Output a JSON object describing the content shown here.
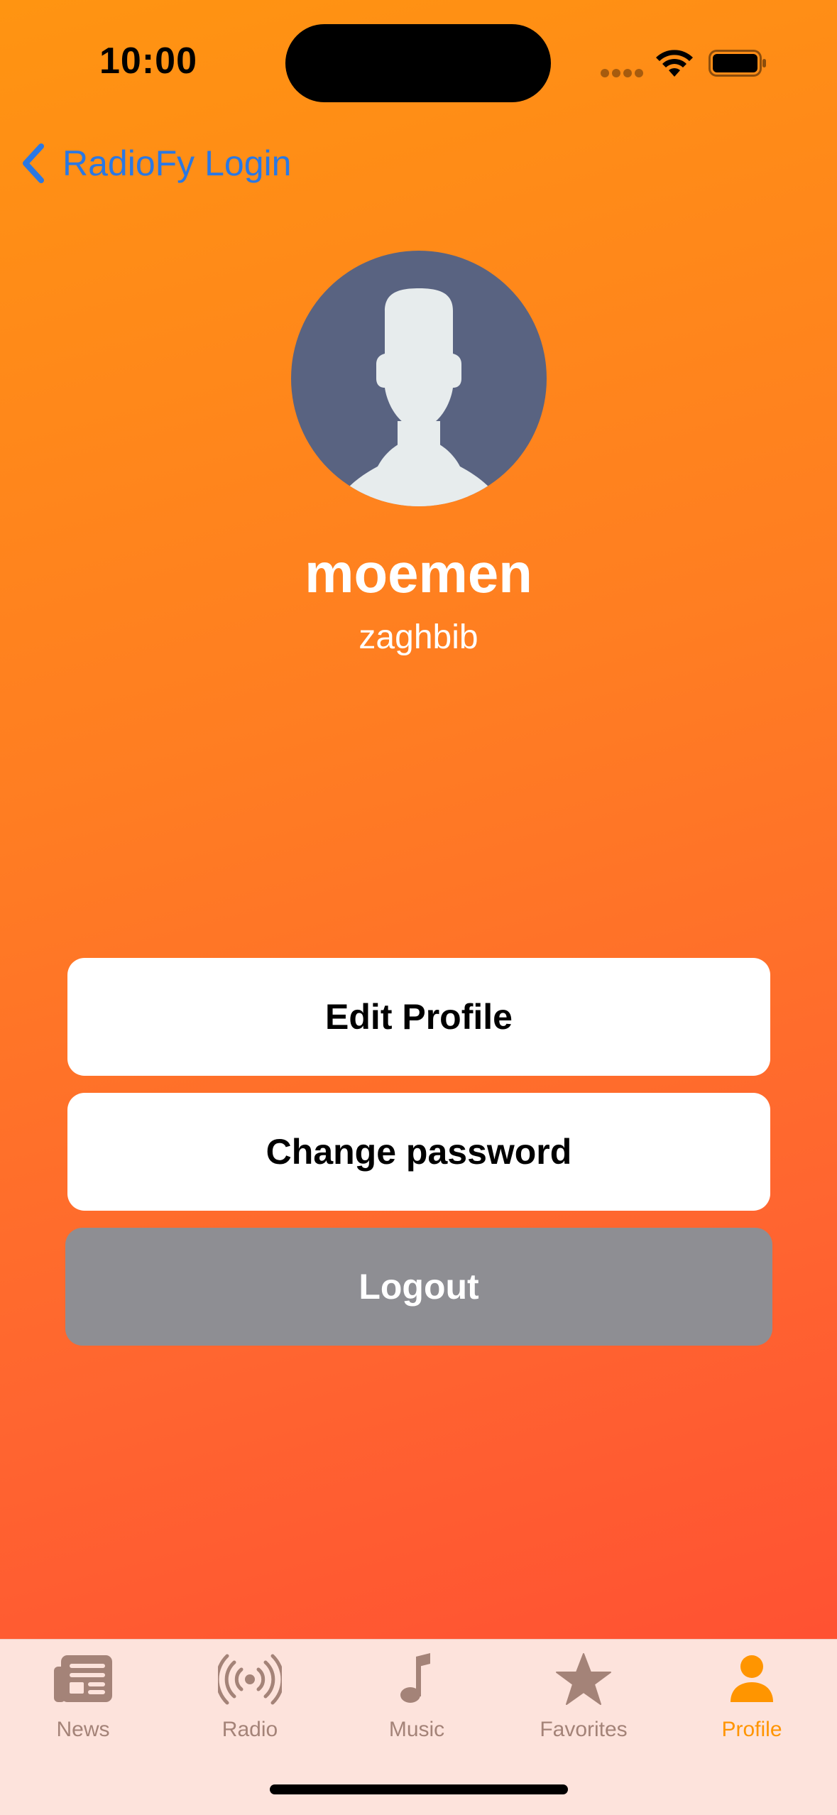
{
  "status_bar": {
    "time": "10:00"
  },
  "nav": {
    "back_label": "RadioFy Login"
  },
  "profile": {
    "name": "moemen",
    "username": "zaghbib"
  },
  "actions": {
    "edit_profile": "Edit Profile",
    "change_password": "Change password",
    "logout": "Logout"
  },
  "tabbar": {
    "tabs": [
      {
        "label": "News",
        "icon": "newspaper-icon",
        "active": false
      },
      {
        "label": "Radio",
        "icon": "radio-broadcast-icon",
        "active": false
      },
      {
        "label": "Music",
        "icon": "music-note-icon",
        "active": false
      },
      {
        "label": "Favorites",
        "icon": "star-icon",
        "active": false
      },
      {
        "label": "Profile",
        "icon": "person-icon",
        "active": true
      }
    ]
  },
  "colors": {
    "accent_active": "#ff9500",
    "link_blue": "#2a78e4",
    "tab_inactive": "#a48378",
    "logout_gray": "#8e8e93"
  }
}
